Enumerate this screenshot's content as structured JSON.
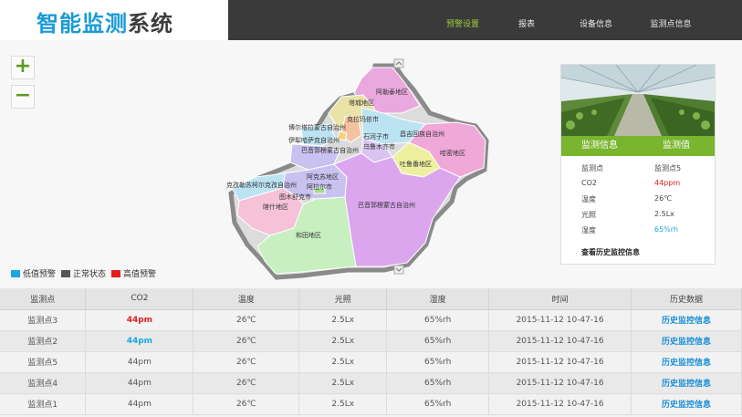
{
  "app": {
    "logo_main": "智能监测",
    "logo_sub": "系统"
  },
  "nav": [
    {
      "label": "预警设置",
      "active": true
    },
    {
      "label": "报表",
      "active": false
    },
    {
      "label": "设备信息",
      "active": false
    },
    {
      "label": "监测点信息",
      "active": false
    }
  ],
  "map": {
    "zoom_in": "+",
    "zoom_out": "−",
    "regions": {
      "altay": "阿勒泰地区",
      "tacheng": "塔城地区",
      "karamay": "克拉玛依市",
      "bortala": "博尔塔拉蒙古自治州",
      "ili": "伊犁哈萨克自治州",
      "shihezi": "石河子市",
      "changji": "昌吉回族自治州",
      "urumqi": "乌鲁木齐市",
      "bayingol_top": "巴音郭楞蒙古自治州",
      "hami": "哈密地区",
      "turpan": "吐鲁番地区",
      "aksu": "阿克苏地区",
      "aral": "阿拉尔市",
      "kizilsu": "克孜勒苏柯尔克孜自治州",
      "tumxuk": "图木舒克市",
      "kashgar": "喀什地区",
      "hotan": "和田地区",
      "bayingol": "巴音郭楞蒙古自治州"
    },
    "legend": [
      {
        "label": "低值预警",
        "color": "#1aa8e0"
      },
      {
        "label": "正常状态",
        "color": "#555555"
      },
      {
        "label": "高值预警",
        "color": "#e02020"
      }
    ]
  },
  "card": {
    "head_left": "监测信息",
    "head_right": "监测值",
    "rows": [
      {
        "key": "监测点",
        "value": "监测点5",
        "color": "#444444"
      },
      {
        "key": "CO2",
        "value": "44ppm",
        "color": "#e02020"
      },
      {
        "key": "温度",
        "value": "26℃",
        "color": "#444444"
      },
      {
        "key": "光照",
        "value": "2.5Lx",
        "color": "#444444"
      },
      {
        "key": "湿度",
        "value": "65%rh",
        "color": "#1aa8e0"
      }
    ],
    "history_link": "查看历史监控信息"
  },
  "table": {
    "headers": [
      "监测点",
      "CO2",
      "温度",
      "光照",
      "湿度",
      "时间",
      "历史数据"
    ],
    "rows": [
      {
        "point": "监测点3",
        "co2": "44pm",
        "co2_status": "red",
        "temp": "26℃",
        "light": "2.5Lx",
        "humidity": "65%rh",
        "time": "2015-11-12 10-47-16",
        "history": "历史监控信息"
      },
      {
        "point": "监测点2",
        "co2": "44pm",
        "co2_status": "blue",
        "temp": "26℃",
        "light": "2.5Lx",
        "humidity": "65%rh",
        "time": "2015-11-12 10-47-16",
        "history": "历史监控信息"
      },
      {
        "point": "监测点5",
        "co2": "44pm",
        "co2_status": "normal",
        "temp": "26℃",
        "light": "2.5Lx",
        "humidity": "65%rh",
        "time": "2015-11-12 10-47-16",
        "history": "历史监控信息"
      },
      {
        "point": "监测点4",
        "co2": "44pm",
        "co2_status": "normal",
        "temp": "26℃",
        "light": "2.5Lx",
        "humidity": "65%rh",
        "time": "2015-11-12 10-47-16",
        "history": "历史监控信息"
      },
      {
        "point": "监测点1",
        "co2": "44pm",
        "co2_status": "normal",
        "temp": "26℃",
        "light": "2.5Lx",
        "humidity": "65%rh",
        "time": "2015-11-12 10-47-16",
        "history": "历史监控信息"
      }
    ]
  }
}
